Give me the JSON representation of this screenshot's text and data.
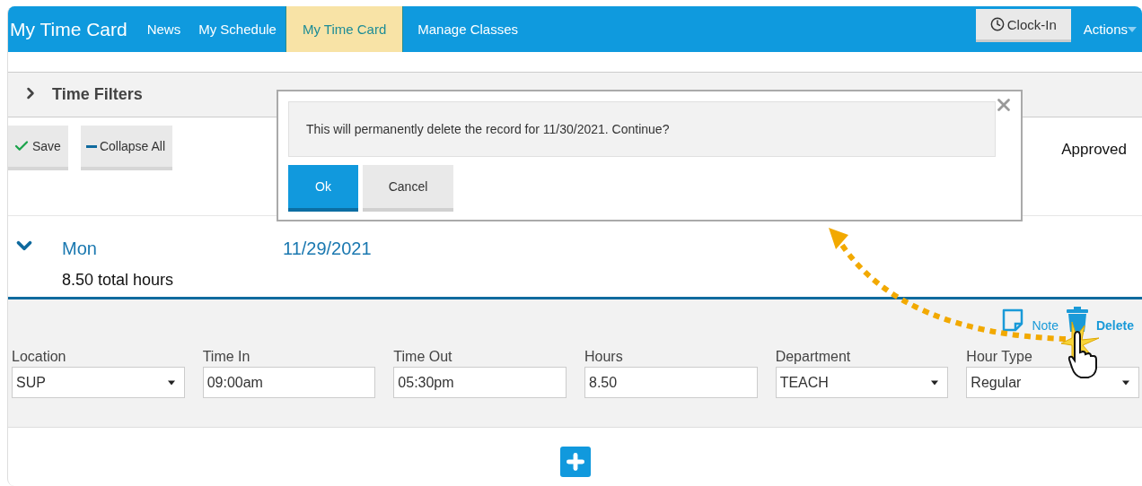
{
  "nav": {
    "title": "My Time Card",
    "items": [
      {
        "label": "News",
        "selected": false
      },
      {
        "label": "My Schedule",
        "selected": false
      },
      {
        "label": "My Time Card",
        "selected": true
      },
      {
        "label": "Manage Classes",
        "selected": false
      }
    ],
    "clock_in": "Clock-In",
    "actions": "Actions"
  },
  "time_filters": {
    "label": "Time Filters",
    "expanded": false
  },
  "toolbar": {
    "buttons": [
      {
        "label": "Save",
        "kind": "save"
      },
      {
        "label": "Collapse All",
        "kind": "collapse"
      }
    ],
    "status": "Approved"
  },
  "day": {
    "weekday": "Mon",
    "date": "11/29/2021",
    "total": "8.50 total hours",
    "expanded": true,
    "links": [
      {
        "label": "Note",
        "kind": "note"
      },
      {
        "label": "Delete",
        "kind": "delete"
      }
    ],
    "fields": [
      {
        "label": "Location",
        "value": "SUP",
        "kind": "select"
      },
      {
        "label": "Time In",
        "value": "09:00am",
        "kind": "text"
      },
      {
        "label": "Time Out",
        "value": "05:30pm",
        "kind": "text"
      },
      {
        "label": "Hours",
        "value": "8.50",
        "kind": "text"
      },
      {
        "label": "Department",
        "value": "TEACH",
        "kind": "select"
      },
      {
        "label": "Hour Type",
        "value": "Regular",
        "kind": "select"
      }
    ]
  },
  "dialog": {
    "message": "This will permanently delete the record for 11/30/2021. Continue?",
    "buttons": [
      {
        "label": "Ok",
        "primary": true
      },
      {
        "label": "Cancel",
        "primary": false
      }
    ]
  }
}
